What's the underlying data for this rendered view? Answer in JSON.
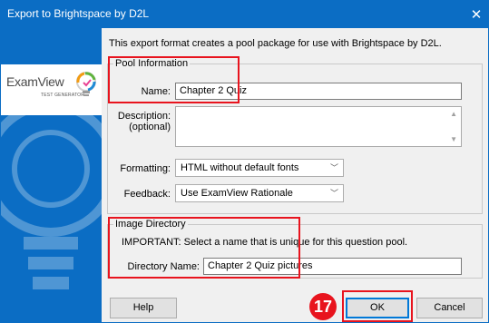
{
  "window": {
    "title": "Export to Brightspace by D2L",
    "close_glyph": "✕"
  },
  "sidebar": {
    "logo_text": "ExamView",
    "logo_sub": "TEST GENERATOR",
    "logo_icon": "examview-logo-icon",
    "background_color": "#0b6dc4"
  },
  "intro_text": "This export format creates a pool package for use with Brightspace by D2L.",
  "pool_information": {
    "group_title": "Pool Information",
    "name_label": "Name:",
    "name_value": "Chapter 2 Quiz",
    "description_label_line1": "Description:",
    "description_label_line2": "(optional)",
    "description_value": "",
    "formatting_label": "Formatting:",
    "formatting_value": "HTML without default fonts",
    "feedback_label": "Feedback:",
    "feedback_value": "Use ExamView Rationale"
  },
  "image_directory": {
    "group_title": "Image Directory",
    "important_text": "IMPORTANT: Select a name that is unique for this question pool.",
    "directory_label": "Directory Name:",
    "directory_value": "Chapter 2 Quiz pictures"
  },
  "buttons": {
    "help": "Help",
    "ok": "OK",
    "cancel": "Cancel"
  },
  "annotation": {
    "step_number": "17",
    "highlight_color": "#e8141e"
  }
}
